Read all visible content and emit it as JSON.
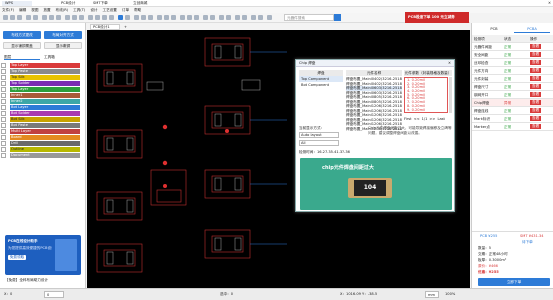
{
  "app": {
    "title": "WPS",
    "tabs": [
      "PCB设计",
      "SMT下单",
      "立创商城"
    ],
    "close_glyph": "✕"
  },
  "menu": [
    "文件(F)",
    "编辑",
    "视图",
    "放置",
    "布线(R)",
    "工具(T)",
    "设计",
    "工艺设置",
    "订单",
    "帮助"
  ],
  "toolbar": {
    "search_placeholder": "元器件搜索"
  },
  "promo": {
    "label": "PCB极速下单 100 元立减券"
  },
  "left_panel": {
    "buttons": [
      "布线方式更改",
      "布局对齐方式",
      "显示铺铜覆盖",
      "显示敷铜"
    ],
    "tabs": [
      "图层",
      "工具箱"
    ],
    "layers": [
      {
        "name": "Top Layer",
        "color": "#d93b3b"
      },
      {
        "name": "Top Paste",
        "color": "#8a8a8a"
      },
      {
        "name": "Top Silk",
        "color": "#e8c300"
      },
      {
        "name": "Top Solder",
        "color": "#7b2cb2"
      },
      {
        "name": "Top Layer",
        "color": "#2d9f3d"
      },
      {
        "name": "Inner1",
        "color": "#a95b3a"
      },
      {
        "name": "Inner2",
        "color": "#3da7a7"
      },
      {
        "name": "Bot Layer",
        "color": "#2d7bd7"
      },
      {
        "name": "Bot Solder",
        "color": "#a83bb0"
      },
      {
        "name": "Bot Silk",
        "color": "#c9a300"
      },
      {
        "name": "Bot Paste",
        "color": "#7a7a7a"
      },
      {
        "name": "Multi Layer",
        "color": "#c04040"
      },
      {
        "name": "Board",
        "color": "#e38a1f"
      },
      {
        "name": "Drill",
        "color": "#6a6a6a"
      },
      {
        "name": "Outline",
        "color": "#b8b800"
      },
      {
        "name": "Document",
        "color": "#999999"
      }
    ],
    "ad": {
      "title": "PCB在线设计助手",
      "subtitle": "为您提供高效便捷的PCB设计服务",
      "button": "免费领取",
      "footer": "【免费】全科布局助力设计"
    }
  },
  "canvas": {
    "tab": "PCB设计1",
    "add": "+"
  },
  "dialog": {
    "title": "Chip 焊盘",
    "close": "✕",
    "list_header": "焊盘",
    "list": [
      "Top Component",
      "Bot Component"
    ],
    "col_headers": [
      "元件名称",
      "元件参数（封装规格及数量）"
    ],
    "parts": [
      "焊盘布置_Mainl0402(3216-2518ml)",
      "焊盘布置_Mainl0402(3216-2518ml)",
      "焊盘布置_Mainl0603(3216-2518ml)",
      "焊盘布置_Mainl0603(3216-2518ml)",
      "焊盘布置_Mainl0805(3216-2518ml)",
      "焊盘布置_Mainl0805(3216-2518ml)",
      "焊盘布置_Mainl1206(3216-2518ml)",
      "焊盘布置_Mainl1206(3216-2518ml)",
      "焊盘布置_Mainl1206(3216-2518ml)",
      "焊盘布置_Mainl1206(3216-2518ml)",
      "焊盘布置_Mainl1206(3216-2518ml)",
      "焊盘布置_Mainl1206(3216-2518ml)"
    ],
    "values": [
      "1. 0.20mil",
      "2. 0.20mil",
      "3. 0.20mil",
      "4. 0.20mil",
      "5. 0.20mil",
      "6. 0.20mil",
      "7. 0.20mil",
      "8. 0.20mil",
      "9. 0.20mil"
    ],
    "pager": [
      "First",
      "<<",
      "1/1",
      ">>",
      "Last"
    ],
    "select_label": "当前显示方式：",
    "select_value": "Auto layout",
    "select2": "All",
    "desc": "Chip元件焊盘间距过大，可能导致焊接偏移及立碑等问题，建议调整焊盘间距以改善。",
    "info": "检测时间：16.27.35.41.3?-36",
    "banner_text": "chip元件焊盘间距过大",
    "chip_label": "104"
  },
  "right_panel": {
    "tabs": [
      "PCB",
      "PCBA"
    ],
    "header": [
      "检测项",
      "状态",
      "操作"
    ],
    "rows": [
      {
        "name": "元器件间距",
        "status": "正常",
        "action": "查看",
        "color": "#2d9f3d"
      },
      {
        "name": "安全间距",
        "status": "正常",
        "action": "查看",
        "color": "#2d9f3d"
      },
      {
        "name": "丝印检查",
        "status": "正常",
        "action": "查看",
        "color": "#2d9f3d"
      },
      {
        "name": "元件方向",
        "status": "正常",
        "action": "查看",
        "color": "#2d9f3d"
      },
      {
        "name": "元件封装",
        "status": "正常",
        "action": "查看",
        "color": "#2d9f3d"
      },
      {
        "name": "焊盘尺寸",
        "status": "正常",
        "action": "查看",
        "color": "#2d9f3d"
      },
      {
        "name": "钢网开口",
        "status": "正常",
        "action": "查看",
        "color": "#2d9f3d"
      },
      {
        "name": "Chip焊盘",
        "status": "异常",
        "action": "查看",
        "color": "#d93b3b"
      },
      {
        "name": "焊盘连线",
        "status": "正常",
        "action": "查看",
        "color": "#2d9f3d"
      },
      {
        "name": "Mark标识",
        "status": "正常",
        "action": "查看",
        "color": "#2d9f3d"
      },
      {
        "name": "Marker点",
        "status": "正常",
        "action": "查看",
        "color": "#2d9f3d"
      }
    ],
    "order_tabs": [
      "PCB ¥255",
      "SMT ¥431.34"
    ],
    "order_note": "待下单",
    "order_lines": [
      "数量：5",
      "交期：正常48小时",
      "板厚：0.3000m²",
      "原价：¥466",
      "优惠：¥255"
    ],
    "order_button": "立即下单"
  },
  "status": {
    "left": "X：0",
    "input": "0",
    "mid": "选中：0",
    "coords": "X：1016.09 Y：-38.5",
    "unit": "mm",
    "zoom": "100%"
  },
  "colors": {
    "accent": "#2d7bd7",
    "danger": "#d93b3b",
    "ok": "#2d9f3d",
    "canvas": "#000000"
  }
}
